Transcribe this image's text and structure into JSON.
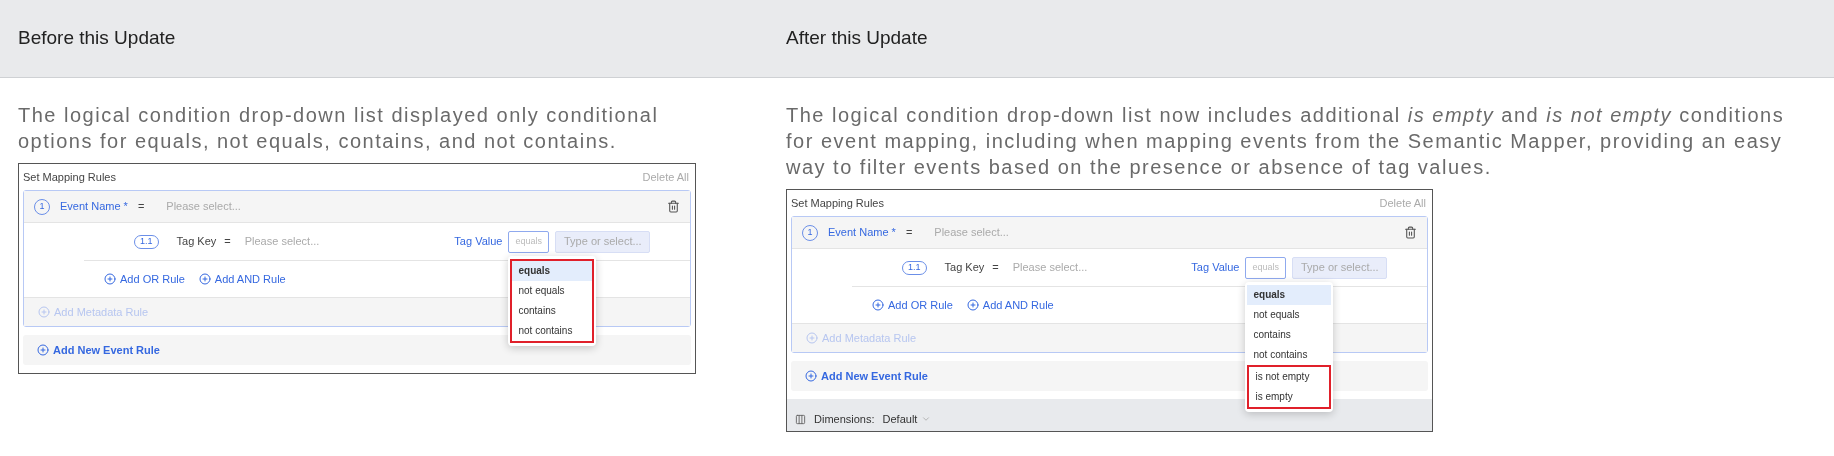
{
  "header": {
    "columns": [
      "Before this Update",
      "After this Update"
    ]
  },
  "panels": [
    {
      "description_lines": [
        "The logical condition drop-down list displayed only conditional",
        "options for equals, not equals, contains, and not contains."
      ],
      "screenshot": {
        "title": "Set Mapping Rules",
        "delete_all": "Delete All",
        "event_rule": {
          "index": "1",
          "label": "Event Name *",
          "operator": "=",
          "placeholder": "Please select..."
        },
        "tag_rule": {
          "index": "1.1",
          "key_label": "Tag Key",
          "operator": "=",
          "key_placeholder": "Please select...",
          "value_label": "Tag Value",
          "condition_value": "equals",
          "value_placeholder": "Type or select..."
        },
        "add_or": "Add OR Rule",
        "add_and": "Add AND Rule",
        "add_metadata": "Add Metadata Rule",
        "add_event": "Add New Event Rule",
        "options": [
          {
            "label": "equals",
            "selected": true,
            "highlighted": true
          },
          {
            "label": "not equals",
            "selected": false,
            "highlighted": true
          },
          {
            "label": "contains",
            "selected": false,
            "highlighted": true
          },
          {
            "label": "not contains",
            "selected": false,
            "highlighted": true
          }
        ]
      }
    },
    {
      "description_lines": [
        "The logical condition drop-down list now includes additional *is empty* and *is not empty* conditions",
        "for event mapping, including when mapping events from the Semantic Mapper, providing an easy",
        "way to filter events based on the presence or absence of tag values."
      ],
      "screenshot": {
        "title": "Set Mapping Rules",
        "delete_all": "Delete All",
        "event_rule": {
          "index": "1",
          "label": "Event Name *",
          "operator": "=",
          "placeholder": "Please select..."
        },
        "tag_rule": {
          "index": "1.1",
          "key_label": "Tag Key",
          "operator": "=",
          "key_placeholder": "Please select...",
          "value_label": "Tag Value",
          "condition_value": "equals",
          "value_placeholder": "Type or select..."
        },
        "add_or": "Add OR Rule",
        "add_and": "Add AND Rule",
        "add_metadata": "Add Metadata Rule",
        "add_event": "Add New Event Rule",
        "options": [
          {
            "label": "equals",
            "selected": true,
            "highlighted": false
          },
          {
            "label": "not equals",
            "selected": false,
            "highlighted": false
          },
          {
            "label": "contains",
            "selected": false,
            "highlighted": false
          },
          {
            "label": "not contains",
            "selected": false,
            "highlighted": false
          },
          {
            "label": "is not empty",
            "selected": false,
            "highlighted": true
          },
          {
            "label": "is empty",
            "selected": false,
            "highlighted": true
          }
        ],
        "footer": {
          "label": "Dimensions:",
          "value": "Default"
        }
      }
    }
  ]
}
